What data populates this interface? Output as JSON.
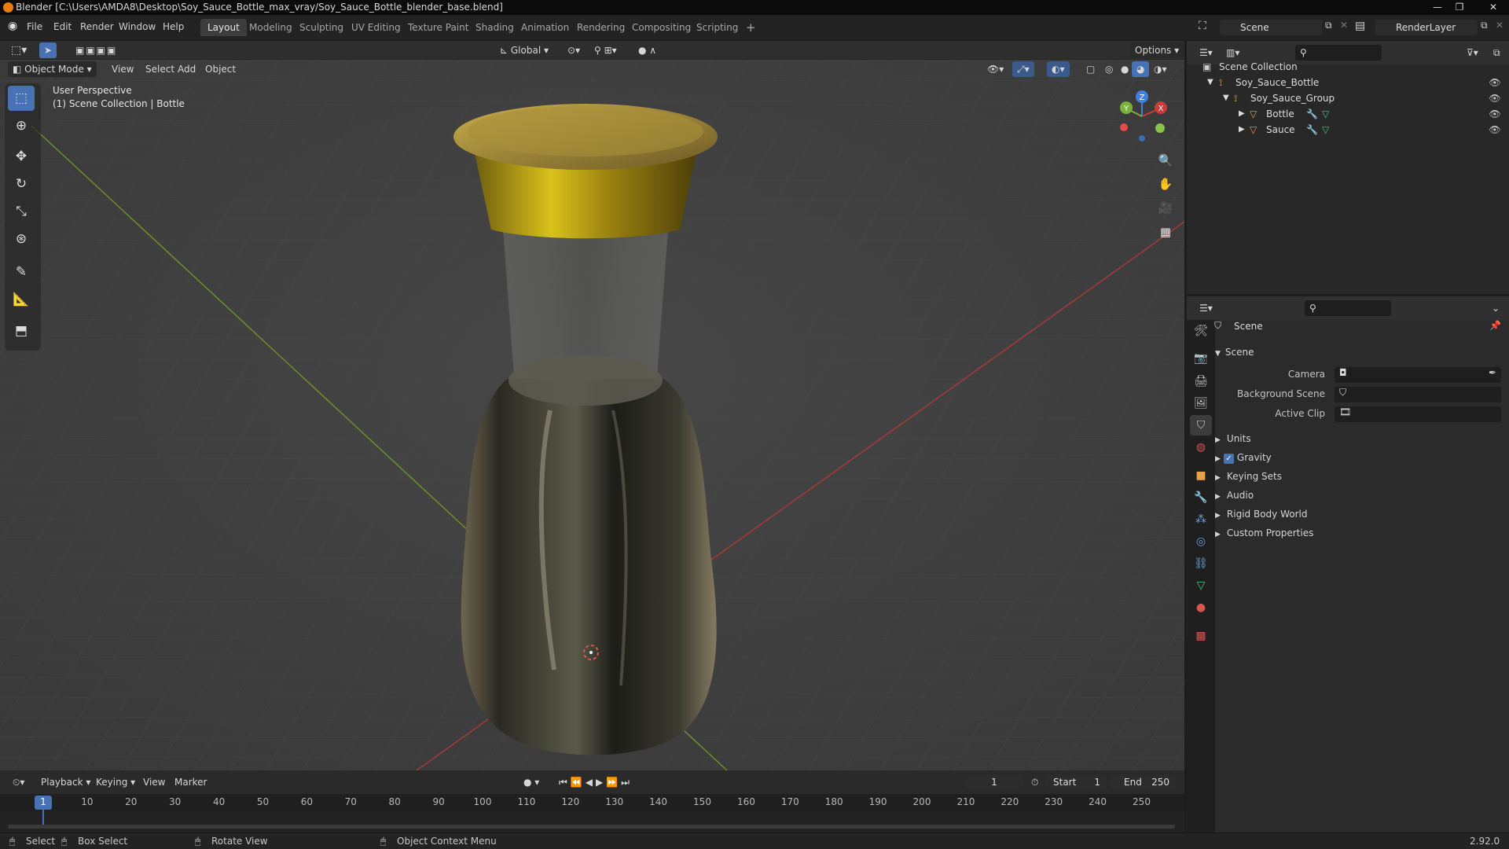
{
  "titlebar": {
    "title": "Blender [C:\\Users\\AMDA8\\Desktop\\Soy_Sauce_Bottle_max_vray/Soy_Sauce_Bottle_blender_base.blend]"
  },
  "menu": [
    "File",
    "Edit",
    "Render",
    "Window",
    "Help"
  ],
  "workspaces": [
    "Layout",
    "Modeling",
    "Sculpting",
    "UV Editing",
    "Texture Paint",
    "Shading",
    "Animation",
    "Rendering",
    "Compositing",
    "Scripting"
  ],
  "topbar": {
    "add_workspace": "+",
    "scene": "Scene",
    "view_layer": "RenderLayer"
  },
  "viewport_header": {
    "orientation": "Global",
    "options": "Options",
    "mode": "Object Mode",
    "menus": [
      "View",
      "Select",
      "Add",
      "Object"
    ]
  },
  "viewport": {
    "overlay_title": "User Perspective",
    "overlay_subtitle": "(1) Scene Collection | Bottle",
    "gizmo": {
      "x": "X",
      "y": "Y",
      "z": "Z"
    },
    "colors": {
      "x_axis": "#c83c3c",
      "y_axis": "#7ab33a",
      "z_axis": "#3c82e6",
      "accent": "#4772b3"
    }
  },
  "toolbar": [
    "select-box",
    "cursor",
    "move",
    "rotate",
    "scale",
    "transform",
    "annotate",
    "measure",
    "add-cube"
  ],
  "outliner": {
    "root": "Scene Collection",
    "collection": "Soy_Sauce_Bottle",
    "group": "Soy_Sauce_Group",
    "objects": [
      "Bottle",
      "Sauce"
    ]
  },
  "properties": {
    "context": "Scene",
    "panel": "Scene",
    "fields": [
      {
        "label": "Camera",
        "value": ""
      },
      {
        "label": "Background Scene",
        "value": ""
      },
      {
        "label": "Active Clip",
        "value": ""
      }
    ],
    "subpanels": [
      "Units",
      "Gravity",
      "Keying Sets",
      "Audio",
      "Rigid Body World",
      "Custom Properties"
    ],
    "gravity_checked": true
  },
  "timeline": {
    "menus": [
      "Playback",
      "Keying",
      "View",
      "Marker"
    ],
    "current_frame": "1",
    "start_label": "Start",
    "start": "1",
    "end_label": "End",
    "end": "250",
    "ticks": [
      "1",
      "10",
      "20",
      "30",
      "40",
      "50",
      "60",
      "70",
      "80",
      "90",
      "100",
      "110",
      "120",
      "130",
      "140",
      "150",
      "160",
      "170",
      "180",
      "190",
      "200",
      "210",
      "220",
      "230",
      "240",
      "250"
    ]
  },
  "statusbar": {
    "select": "Select",
    "box_select": "Box Select",
    "rotate_view": "Rotate View",
    "context_menu": "Object Context Menu",
    "version": "2.92.0"
  }
}
